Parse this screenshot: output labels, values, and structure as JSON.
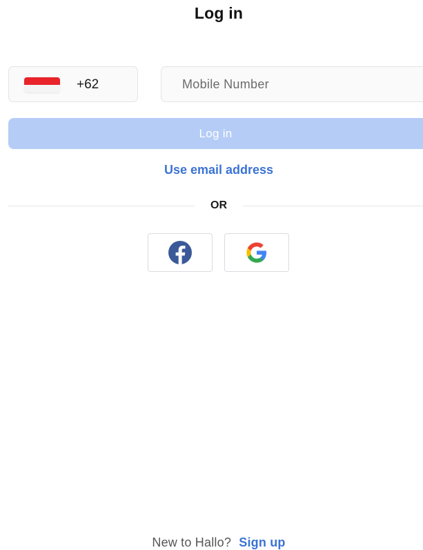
{
  "header": {
    "title": "Log in"
  },
  "phone": {
    "country_flag_icon": "indonesia-flag-icon",
    "country_code": "+62",
    "placeholder": "Mobile Number",
    "value": ""
  },
  "login_button": {
    "label": "Log in",
    "color": "#b5ccf6"
  },
  "email_link": {
    "label": "Use email address"
  },
  "divider": {
    "label": "OR"
  },
  "social": {
    "buttons": [
      {
        "icon": "facebook-icon",
        "color": "#3b5998"
      },
      {
        "icon": "google-icon",
        "colors": [
          "#4285f4",
          "#ea4335",
          "#fbbc05",
          "#34a853"
        ]
      }
    ]
  },
  "footer": {
    "prompt": "New to Hallo?",
    "signup_label": "Sign up"
  },
  "theme": {
    "accent": "#3b73d4"
  }
}
